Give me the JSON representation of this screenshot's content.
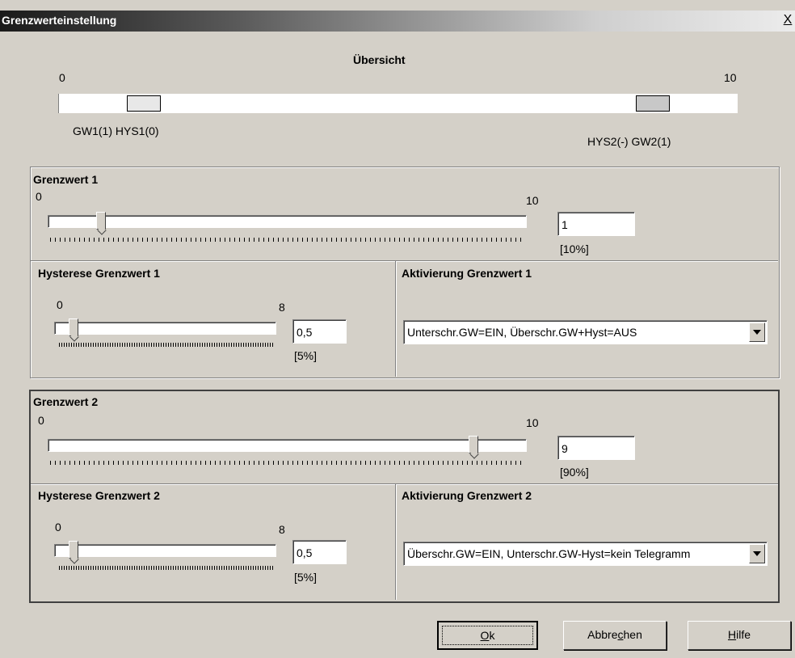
{
  "window": {
    "title": "Grenzwerteinstellung",
    "close_label": "X"
  },
  "overview": {
    "heading": "Übersicht",
    "min_label": "0",
    "max_label": "10",
    "left_label": "GW1(1) HYS1(0)",
    "right_label": "HYS2(-) GW2(1)"
  },
  "limit1": {
    "heading": "Grenzwert 1",
    "min_label": "0",
    "max_label": "10",
    "slider_fraction": 0.1,
    "value": "1",
    "percent": "[10%]",
    "hysteresis": {
      "heading": "Hysterese Grenzwert 1",
      "min_label": "0",
      "max_label": "8",
      "slider_fraction": 0.0625,
      "value": "0,5",
      "percent": "[5%]"
    },
    "activation": {
      "heading": "Aktivierung Grenzwert 1",
      "selected": "Unterschr.GW=EIN, Überschr.GW+Hyst=AUS"
    }
  },
  "limit2": {
    "heading": "Grenzwert 2",
    "min_label": "0",
    "max_label": "10",
    "slider_fraction": 0.9,
    "value": "9",
    "percent": "[90%]",
    "hysteresis": {
      "heading": "Hysterese Grenzwert 2",
      "min_label": "0",
      "max_label": "8",
      "slider_fraction": 0.0625,
      "value": "0,5",
      "percent": "[5%]"
    },
    "activation": {
      "heading": "Aktivierung Grenzwert 2",
      "selected": "Überschr.GW=EIN, Unterschr.GW-Hyst=kein Telegramm"
    }
  },
  "buttons": {
    "ok_mnemonic": "O",
    "ok_rest": "k",
    "cancel_before": "Abbre",
    "cancel_mnemonic": "c",
    "cancel_after": "hen",
    "help_mnemonic": "H",
    "help_rest": "ilfe"
  }
}
